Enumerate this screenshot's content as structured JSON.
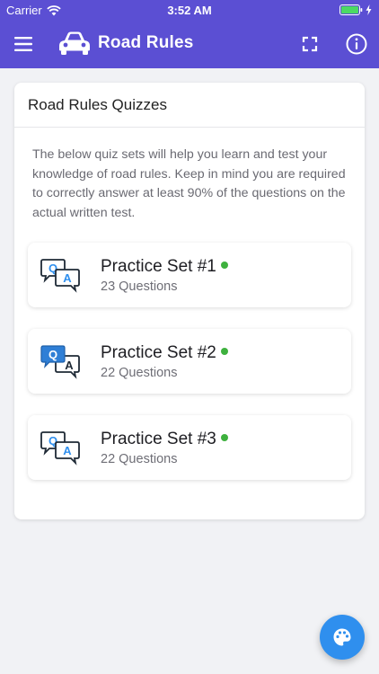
{
  "status_bar": {
    "carrier": "Carrier",
    "time": "3:52 AM"
  },
  "app_bar": {
    "title": "Road Rules",
    "icons": [
      "menu-icon",
      "car-icon",
      "fullscreen-icon",
      "info-icon"
    ]
  },
  "card": {
    "header": "Road Rules Quizzes",
    "description": "The below quiz sets will help you learn and test your knowledge of road rules. Keep in mind you are required to correctly answer at least 90% of the questions on the actual written test.",
    "items": [
      {
        "title": "Practice Set #1",
        "count": "23 Questions",
        "icon": "qa-outline-icon"
      },
      {
        "title": "Practice Set #2",
        "count": "22 Questions",
        "icon": "qa-filled-icon"
      },
      {
        "title": "Practice Set #3",
        "count": "22 Questions",
        "icon": "qa-outline-icon"
      }
    ]
  },
  "colors": {
    "header": "#5b4fd3",
    "accent_blue": "#2f8fee",
    "status_dot": "#3eb13e",
    "battery": "#4cd964"
  },
  "fab": {
    "icon": "palette-icon"
  }
}
